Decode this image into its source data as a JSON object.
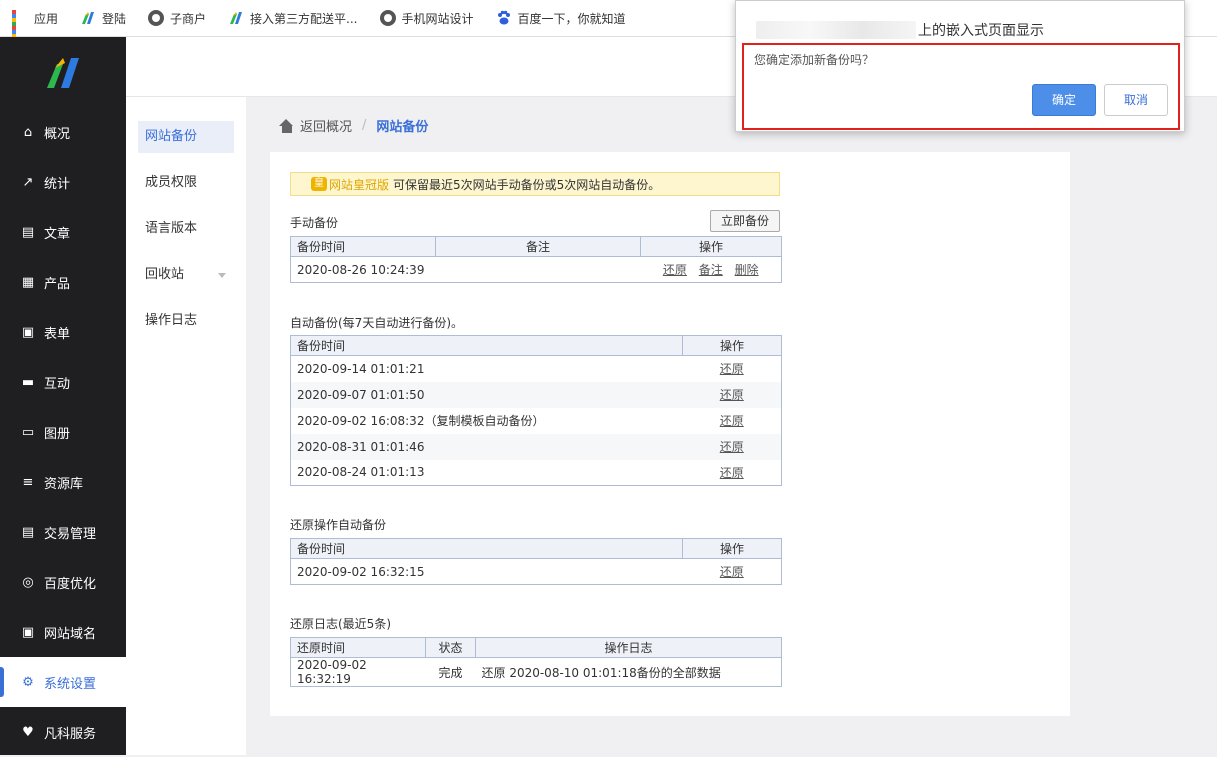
{
  "bookmarks": [
    {
      "label": "应用",
      "icon": "apps-grid-icon"
    },
    {
      "label": "登陆",
      "icon": "fanke-logo-icon"
    },
    {
      "label": "子商户",
      "icon": "globe-icon"
    },
    {
      "label": "接入第三方配送平...",
      "icon": "fanke-logo-icon"
    },
    {
      "label": "手机网站设计",
      "icon": "globe-icon"
    },
    {
      "label": "百度一下，你就知道",
      "icon": "baidu-paw-icon"
    }
  ],
  "sidebar": {
    "items": [
      {
        "label": "概况",
        "icon": "home-icon"
      },
      {
        "label": "统计",
        "icon": "chart-icon"
      },
      {
        "label": "文章",
        "icon": "article-icon"
      },
      {
        "label": "产品",
        "icon": "product-icon"
      },
      {
        "label": "表单",
        "icon": "form-icon"
      },
      {
        "label": "互动",
        "icon": "chat-icon"
      },
      {
        "label": "图册",
        "icon": "album-icon"
      },
      {
        "label": "资源库",
        "icon": "database-icon"
      },
      {
        "label": "交易管理",
        "icon": "trade-icon"
      },
      {
        "label": "百度优化",
        "icon": "seo-icon"
      },
      {
        "label": "网站域名",
        "icon": "domain-icon"
      },
      {
        "label": "系统设置",
        "icon": "gear-icon"
      },
      {
        "label": "凡科服务",
        "icon": "heart-icon"
      }
    ],
    "active": "系统设置"
  },
  "subnav": {
    "items": [
      {
        "label": "网站备份"
      },
      {
        "label": "成员权限"
      },
      {
        "label": "语言版本"
      },
      {
        "label": "回收站"
      },
      {
        "label": "操作日志"
      }
    ],
    "active": "网站备份"
  },
  "breadcrumb": {
    "back": "返回概况",
    "separator": "/",
    "current": "网站备份"
  },
  "notice": {
    "tag": "网站皇冠版",
    "text": "可保留最近5次网站手动备份或5次网站自动备份。"
  },
  "manual": {
    "title": "手动备份",
    "button": "立即备份",
    "headers": [
      "备份时间",
      "备注",
      "操作"
    ],
    "rows": [
      {
        "time": "2020-08-26 10:24:39",
        "note": "",
        "actions": [
          "还原",
          "备注",
          "删除"
        ]
      }
    ]
  },
  "auto": {
    "title": "自动备份(每7天自动进行备份)。",
    "headers": [
      "备份时间",
      "操作"
    ],
    "rows": [
      {
        "time": "2020-09-14 01:01:21",
        "action": "还原"
      },
      {
        "time": "2020-09-07 01:01:50",
        "action": "还原"
      },
      {
        "time": "2020-09-02 16:08:32（复制模板自动备份）",
        "action": "还原"
      },
      {
        "time": "2020-08-31 01:01:46",
        "action": "还原"
      },
      {
        "time": "2020-08-24 01:01:13",
        "action": "还原"
      }
    ]
  },
  "restore_auto": {
    "title": "还原操作自动备份",
    "headers": [
      "备份时间",
      "操作"
    ],
    "rows": [
      {
        "time": "2020-09-02 16:32:15",
        "action": "还原"
      }
    ]
  },
  "restore_log": {
    "title": "还原日志(最近5条)",
    "headers": [
      "还原时间",
      "状态",
      "操作日志"
    ],
    "rows": [
      {
        "time": "2020-09-02 16:32:19",
        "status": "完成",
        "log": "还原 2020-08-10 01:01:18备份的全部数据"
      }
    ]
  },
  "dialog": {
    "origin_suffix": "上的嵌入式页面显示",
    "message": "您确定添加新备份吗？",
    "ok": "确定",
    "cancel": "取消"
  },
  "colors": {
    "accent": "#3a6fd8",
    "sidebar_bg": "#1f1f22",
    "highlight_border": "#e0211c",
    "ok_button": "#4c8ee8"
  }
}
